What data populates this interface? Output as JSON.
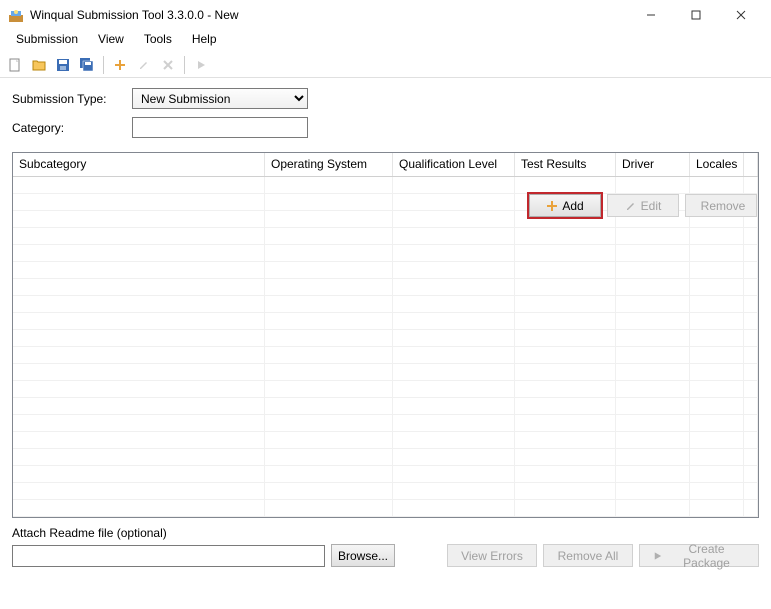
{
  "window": {
    "title": "Winqual Submission Tool 3.3.0.0 - New"
  },
  "menu": {
    "submission": "Submission",
    "view": "View",
    "tools": "Tools",
    "help": "Help"
  },
  "form": {
    "submission_type_label": "Submission Type:",
    "submission_type_value": "New Submission",
    "category_label": "Category:",
    "category_value": ""
  },
  "action_buttons": {
    "add": "Add",
    "edit": "Edit",
    "remove": "Remove"
  },
  "grid": {
    "columns": {
      "subcategory": "Subcategory",
      "os": "Operating System",
      "ql": "Qualification Level",
      "tr": "Test Results",
      "dr": "Driver",
      "lo": "Locales"
    }
  },
  "attach": {
    "label": "Attach Readme file (optional)",
    "value": "",
    "browse": "Browse..."
  },
  "bottom_buttons": {
    "view_errors": "View Errors",
    "remove_all": "Remove All",
    "create_package": "Create Package"
  }
}
